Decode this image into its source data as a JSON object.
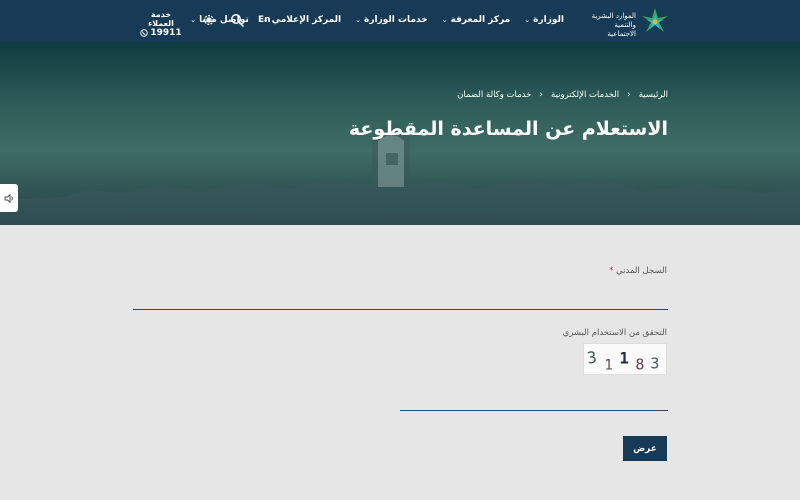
{
  "header": {
    "logo_text": "الموارد البشرية والتنمية الاجتماعية",
    "nav": [
      {
        "label": "الوزارة"
      },
      {
        "label": "مركز المعرفة"
      },
      {
        "label": "خدمات الوزارة"
      },
      {
        "label": "المركز الإعلامي"
      },
      {
        "label": "تواصل معنا"
      }
    ],
    "lang_label": "En",
    "search_icon": "search-icon",
    "settings_icon": "gear-icon",
    "customer_service": {
      "title": "خدمة العملاء",
      "phone": "19911"
    }
  },
  "hero": {
    "breadcrumb": [
      "الرئيسية",
      "الخدمات الإلكترونية",
      "خدمات وكالة الضمان"
    ],
    "title": "الاستعلام عن المساعدة المقطوعة"
  },
  "form": {
    "id_label": "السجل المدني",
    "id_required_mark": "*",
    "id_value": "",
    "captcha_label": "التحقق من الاستخدام البشري",
    "captcha_text": "31183",
    "captcha_value": "",
    "submit_label": "عرض"
  },
  "colors": {
    "header_bg": "#173a56",
    "logo_green": "#3aa55b",
    "logo_teal": "#2bb8c4",
    "button_bg": "#173a56"
  }
}
